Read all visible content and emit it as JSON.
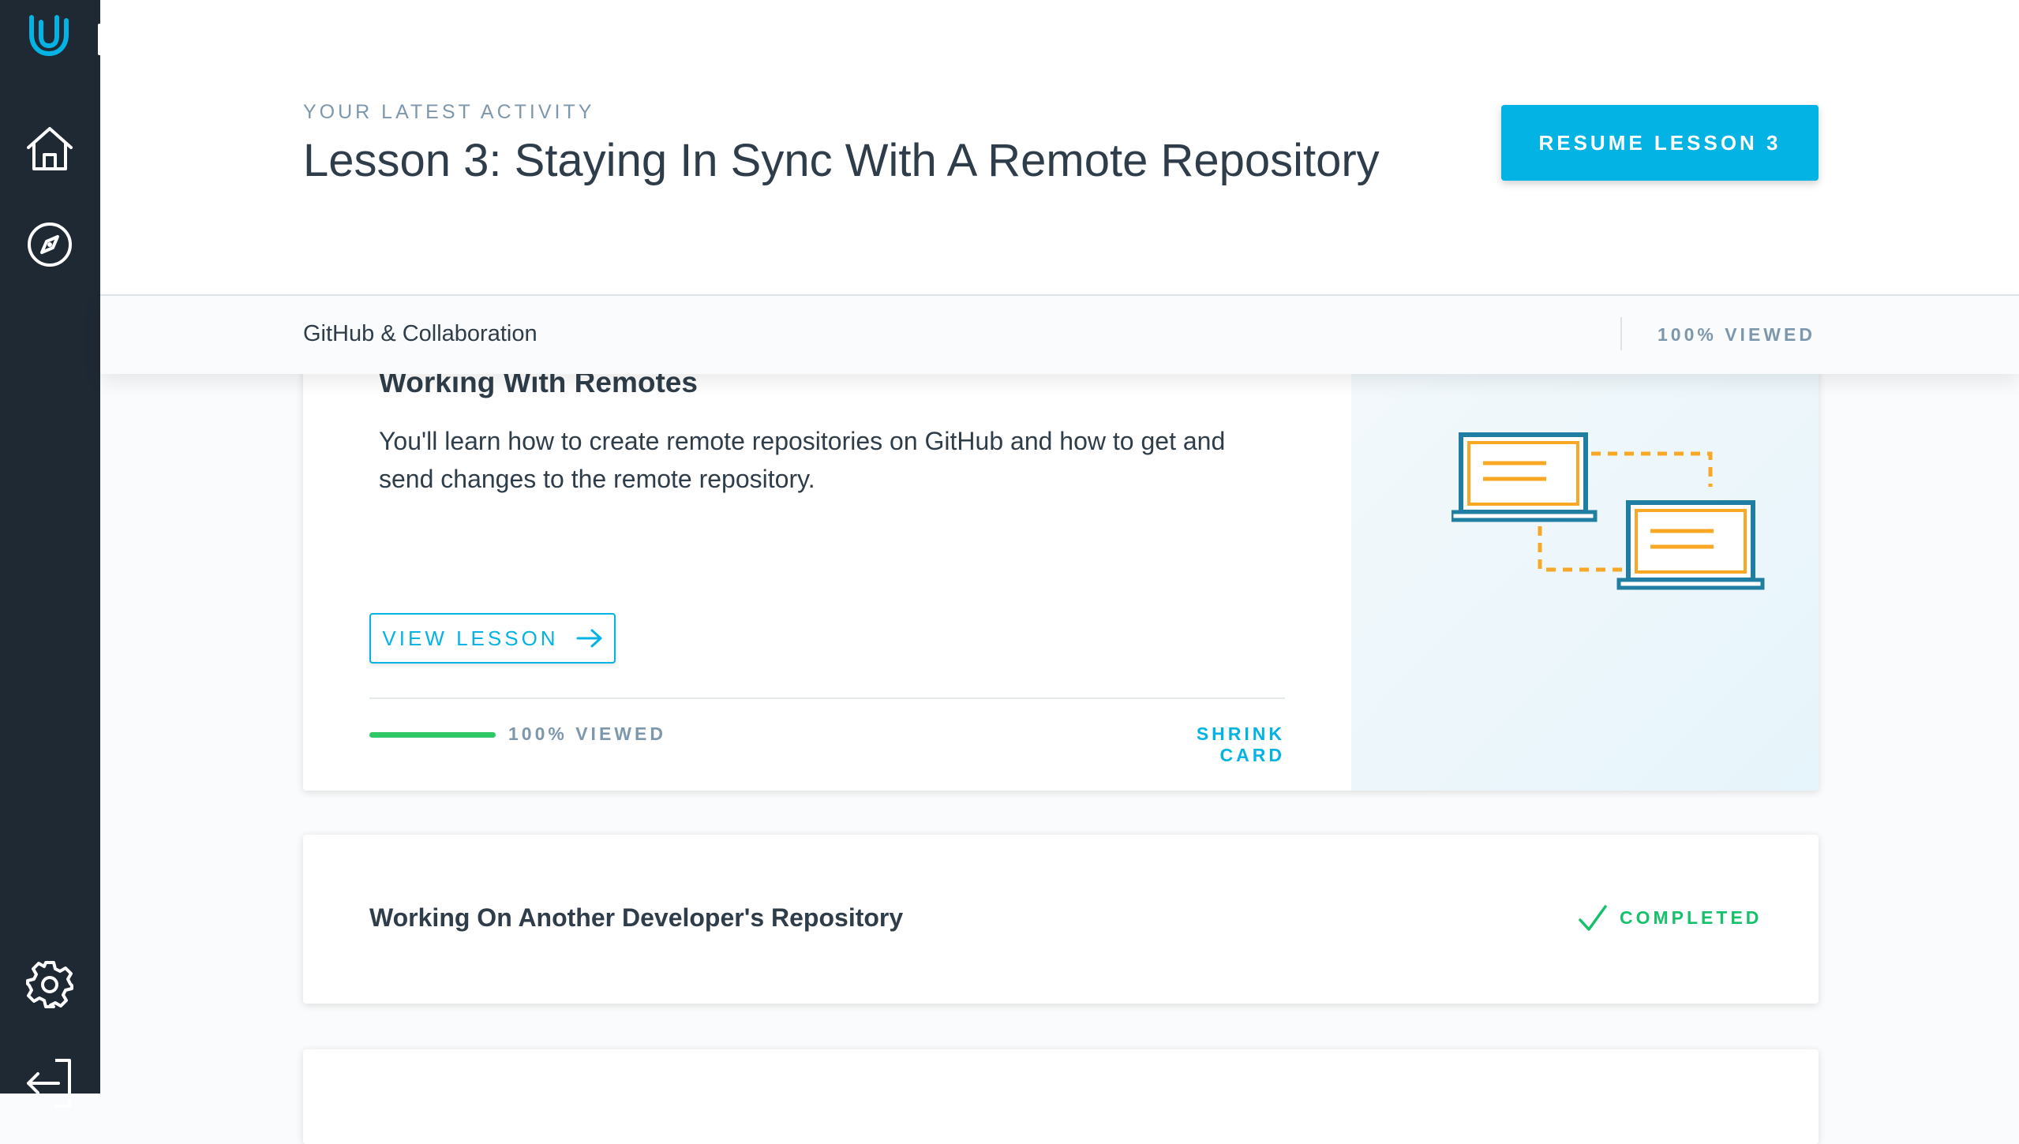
{
  "sidebar": {
    "logo": "udacity-logo-icon",
    "items": [
      {
        "icon": "home-icon"
      },
      {
        "icon": "compass-icon"
      },
      {
        "icon": "gear-icon"
      },
      {
        "icon": "logout-icon"
      }
    ]
  },
  "header": {
    "eyebrow": "YOUR LATEST ACTIVITY",
    "title": "Lesson 3: Staying In Sync With A Remote Repository",
    "resume_button": "RESUME LESSON 3"
  },
  "subbar": {
    "course": "GitHub & Collaboration",
    "viewed": "100% VIEWED"
  },
  "lessons": [
    {
      "title": "Working With Remotes",
      "description": "You'll learn how to create remote repositories on GitHub and how to get and send changes to the remote repository.",
      "view_button": "VIEW LESSON",
      "progress": 1.0,
      "viewed": "100% VIEWED",
      "shrink": "SHRINK CARD",
      "illustration": "two-laptops-sync-illustration"
    },
    {
      "title": "Working On Another Developer's Repository",
      "status": "COMPLETED"
    }
  ],
  "colors": {
    "sidebar": "#1f2933",
    "accent": "#02b3e4",
    "success": "#15c26b",
    "progress": "#2ec866",
    "muted": "#7d97ad"
  }
}
